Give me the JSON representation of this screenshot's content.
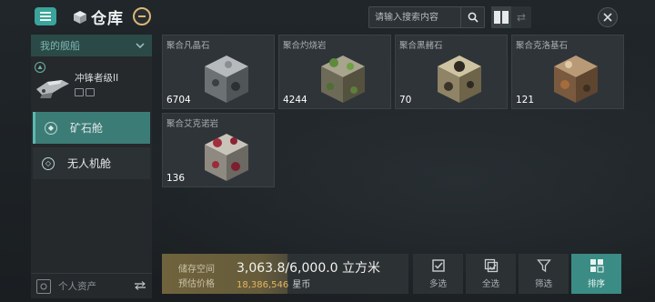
{
  "header": {
    "title": "仓库",
    "search_placeholder": "请输入搜索内容"
  },
  "sidebar": {
    "ships_dropdown": "我的舰船",
    "ship_name": "冲锋者级II",
    "holds": [
      {
        "label": "矿石舱",
        "active": true
      },
      {
        "label": "无人机舱",
        "active": false
      }
    ],
    "personal_assets": "个人资产"
  },
  "items": [
    {
      "name": "聚合凡晶石",
      "qty": "6704",
      "color": "#8a8e92"
    },
    {
      "name": "聚合灼烧岩",
      "qty": "4244",
      "color": "#6f7a4e"
    },
    {
      "name": "聚合黑赭石",
      "qty": "70",
      "color": "#8a7a5a"
    },
    {
      "name": "聚合克洛基石",
      "qty": "121",
      "color": "#9a7450"
    },
    {
      "name": "聚合艾克诺岩",
      "qty": "136",
      "color": "#8e4a52"
    }
  ],
  "storage": {
    "space_label": "储存空间",
    "value_label": "预估价格",
    "volume": "3,063.8/6,000.0 立方米",
    "fill_fraction": 0.51,
    "value": "18,386,546",
    "currency": "星币"
  },
  "toolbar": {
    "multi_select": "多选",
    "select_all": "全选",
    "filter": "筛选",
    "sort": "排序"
  },
  "colors": {
    "accent": "#3aa39a",
    "gold": "#e2b65f"
  }
}
